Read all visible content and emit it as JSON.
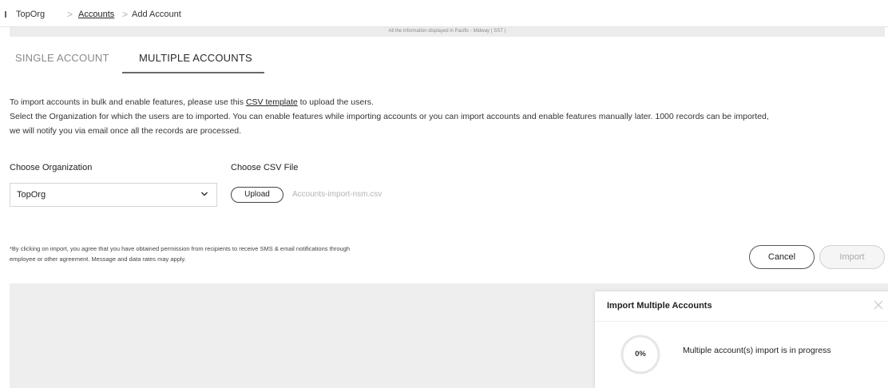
{
  "breadcrumb": {
    "items": [
      "TopOrg",
      "Accounts",
      "Add Account"
    ],
    "separator": ">"
  },
  "timezone_notice": "All the information displayed in Pacific - Midway ( SST )",
  "tabs": [
    {
      "label": "SINGLE ACCOUNT",
      "active": false
    },
    {
      "label": "MULTIPLE ACCOUNTS",
      "active": true
    }
  ],
  "instructions": {
    "line1_before": "To import accounts in bulk and enable features, please use this ",
    "csv_link": "CSV template",
    "line1_after": " to upload the users.",
    "line2": "Select the Organization for which the users are to imported. You can enable features while importing accounts or you can import accounts and enable features manually later. 1000 records can be imported,",
    "line3": "we will notify you via email once all the records are processed."
  },
  "organization": {
    "label": "Choose Organization",
    "selected": "TopOrg"
  },
  "csv_file": {
    "label": "Choose CSV File",
    "upload_label": "Upload",
    "file_name": "Accounts-import-nsm.csv"
  },
  "disclaimer": {
    "line1": "*By clicking on import, you agree that you have obtained permission from recipients to receive SMS & email notifications through",
    "line2": "employee or other agreement. Message and data rates may apply."
  },
  "actions": {
    "cancel_label": "Cancel",
    "import_label": "Import"
  },
  "import_panel": {
    "title": "Import Multiple Accounts",
    "progress": 0,
    "progress_label": "0%",
    "message": "Multiple account(s) import is in progress"
  },
  "colors": {
    "active_tab_underline": "#6a6a6a",
    "muted_text": "#8a8a8a",
    "disabled_button": "#aaaaaa",
    "background_gray": "#eeeeee"
  },
  "icons": {
    "chevron": "chevron-down-icon",
    "close": "close-icon"
  }
}
